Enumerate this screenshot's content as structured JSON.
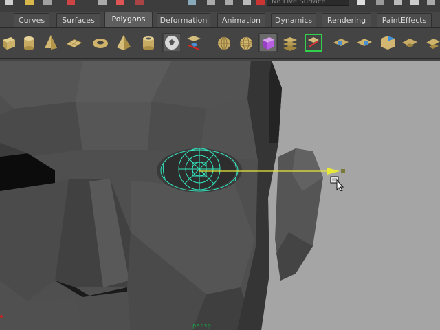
{
  "top_strip": {
    "live_surface": "No Live Surface"
  },
  "shelf_tabs": [
    {
      "label": "Curves",
      "active": false
    },
    {
      "label": "Surfaces",
      "active": false
    },
    {
      "label": "Polygons",
      "active": true
    },
    {
      "label": "Deformation",
      "active": false
    },
    {
      "label": "Animation",
      "active": false
    },
    {
      "label": "Dynamics",
      "active": false
    },
    {
      "label": "Rendering",
      "active": false
    },
    {
      "label": "PaintEffects",
      "active": false
    }
  ],
  "shelf_icons": [
    "poly-cube-icon",
    "poly-cylinder-icon",
    "poly-cone-icon",
    "poly-plane-icon",
    "poly-torus-icon",
    "poly-pyramid-icon",
    "poly-pipe-icon",
    "soccer-ball-icon",
    "split-polygon-icon",
    "combine-icon",
    "sphere-icon",
    "sphere-smooth-icon",
    "cube-highlighted-icon",
    "extract-icon",
    "plane-faces-icon",
    "bridge-icon",
    "cut-faces-icon",
    "wedge-icon",
    "smooth-icon",
    "mirror-icon"
  ],
  "viewport": {
    "camera": "persp",
    "colors": {
      "background": "#a5a5a5",
      "selection": "#33e8c0",
      "manipulator": "#e8e83a"
    }
  }
}
